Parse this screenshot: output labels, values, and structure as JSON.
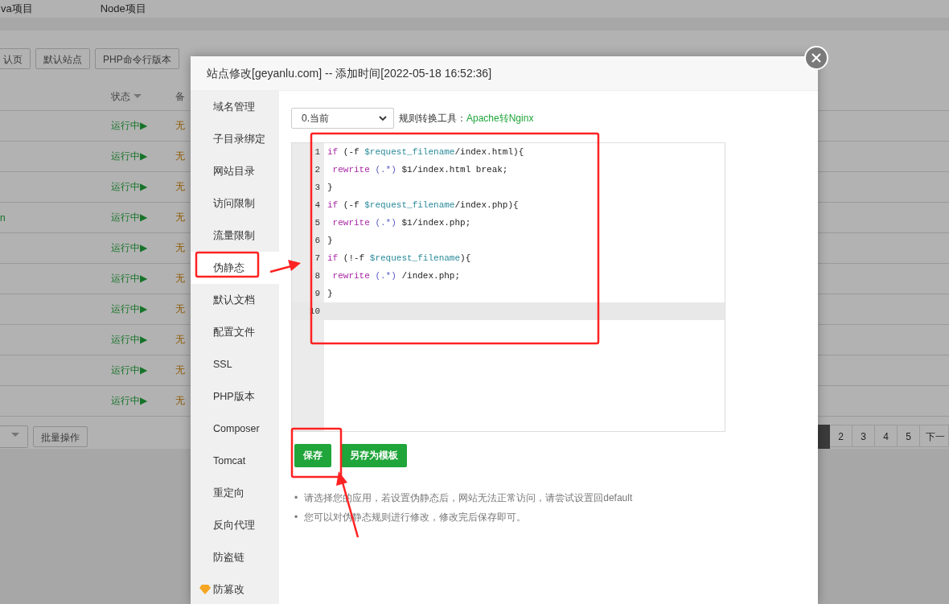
{
  "background": {
    "nav_tabs": [
      "va项目",
      "Node项目"
    ],
    "toolbar_buttons": [
      "认页",
      "默认站点",
      "PHP命令行版本"
    ],
    "table": {
      "columns": [
        "状态",
        "备"
      ],
      "rows": [
        {
          "status": "运行中▶",
          "backup": "无"
        },
        {
          "status": "运行中▶",
          "backup": "无"
        },
        {
          "status": "运行中▶",
          "backup": "无"
        },
        {
          "column_1": "n",
          "status": "运行中▶",
          "backup": "无"
        },
        {
          "status": "运行中▶",
          "backup": "无"
        },
        {
          "status": "运行中▶",
          "backup": "无"
        },
        {
          "status": "运行中▶",
          "backup": "无"
        },
        {
          "status": "运行中▶",
          "backup": "无"
        },
        {
          "status": "运行中▶",
          "backup": "无"
        },
        {
          "status": "运行中▶",
          "backup": "无"
        }
      ]
    },
    "batch_button": "批量操作",
    "pagination": [
      "2",
      "3",
      "4",
      "5",
      "下一"
    ]
  },
  "dialog": {
    "title": "站点修改[geyanlu.com] -- 添加时间[2022-05-18 16:52:36]",
    "menu": [
      {
        "label": "域名管理",
        "selected": false
      },
      {
        "label": "子目录绑定",
        "selected": false
      },
      {
        "label": "网站目录",
        "selected": false
      },
      {
        "label": "访问限制",
        "selected": false
      },
      {
        "label": "流量限制",
        "selected": false
      },
      {
        "label": "伪静态",
        "selected": true
      },
      {
        "label": "默认文档",
        "selected": false
      },
      {
        "label": "配置文件",
        "selected": false
      },
      {
        "label": "SSL",
        "selected": false
      },
      {
        "label": "PHP版本",
        "selected": false
      },
      {
        "label": "Composer",
        "selected": false
      },
      {
        "label": "Tomcat",
        "selected": false
      },
      {
        "label": "重定向",
        "selected": false
      },
      {
        "label": "反向代理",
        "selected": false
      },
      {
        "label": "防盗链",
        "selected": false
      },
      {
        "label": "防篡改",
        "selected": false,
        "premium": true
      }
    ],
    "template_select": "0.当前",
    "converter_label": "规则转换工具：",
    "converter_link": "Apache转Nginx",
    "code_lines": [
      {
        "number": "1",
        "active": false,
        "tokens": [
          {
            "kind": "keyword",
            "text": "if"
          },
          {
            "kind": "plain",
            "text": " (-f "
          },
          {
            "kind": "variable",
            "text": "$request_filename"
          },
          {
            "kind": "plain",
            "text": "/index.html){"
          }
        ]
      },
      {
        "number": "2",
        "active": false,
        "tokens": [
          {
            "kind": "keyword",
            "text": " rewrite"
          },
          {
            "kind": "regex",
            "text": " (.*)"
          },
          {
            "kind": "plain",
            "text": " $1/index.html break;"
          }
        ]
      },
      {
        "number": "3",
        "active": false,
        "tokens": [
          {
            "kind": "plain",
            "text": "}"
          }
        ]
      },
      {
        "number": "4",
        "active": false,
        "tokens": [
          {
            "kind": "keyword",
            "text": "if"
          },
          {
            "kind": "plain",
            "text": " (-f "
          },
          {
            "kind": "variable",
            "text": "$request_filename"
          },
          {
            "kind": "plain",
            "text": "/index.php){"
          }
        ]
      },
      {
        "number": "5",
        "active": false,
        "tokens": [
          {
            "kind": "keyword",
            "text": " rewrite"
          },
          {
            "kind": "regex",
            "text": " (.*)"
          },
          {
            "kind": "plain",
            "text": " $1/index.php;"
          }
        ]
      },
      {
        "number": "6",
        "active": false,
        "tokens": [
          {
            "kind": "plain",
            "text": "}"
          }
        ]
      },
      {
        "number": "7",
        "active": false,
        "tokens": [
          {
            "kind": "keyword",
            "text": "if"
          },
          {
            "kind": "plain",
            "text": " (!-f "
          },
          {
            "kind": "variable",
            "text": "$request_filename"
          },
          {
            "kind": "plain",
            "text": "){"
          }
        ]
      },
      {
        "number": "8",
        "active": false,
        "tokens": [
          {
            "kind": "keyword",
            "text": " rewrite"
          },
          {
            "kind": "regex",
            "text": " (.*)"
          },
          {
            "kind": "plain",
            "text": " /index.php;"
          }
        ]
      },
      {
        "number": "9",
        "active": false,
        "tokens": [
          {
            "kind": "plain",
            "text": "}"
          }
        ]
      },
      {
        "number": "10",
        "active": true
      }
    ],
    "buttons": [
      "保存",
      "另存为模板"
    ],
    "tips": [
      {
        "bullet": "•",
        "text": "请选择您的应用，若设置伪静态后，网站无法正常访问，请尝试设置回default"
      },
      {
        "bullet": "•",
        "text": "您可以对伪静态规则进行修改，修改完后保存即可。"
      }
    ]
  }
}
